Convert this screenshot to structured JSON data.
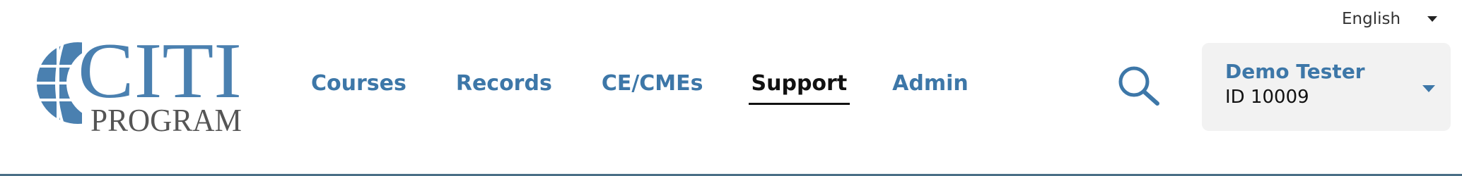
{
  "language": {
    "selected": "English",
    "caret_icon": "caret-down-icon"
  },
  "logo": {
    "line1": "CITI",
    "line2": "PROGRAM",
    "icon": "globe-icon"
  },
  "nav": {
    "items": [
      {
        "label": "Courses",
        "active": false
      },
      {
        "label": "Records",
        "active": false
      },
      {
        "label": "CE/CMEs",
        "active": false
      },
      {
        "label": "Support",
        "active": true
      },
      {
        "label": "Admin",
        "active": false
      }
    ]
  },
  "search": {
    "icon": "search-icon"
  },
  "user": {
    "name": "Demo Tester",
    "id_text": "ID 10009",
    "caret_icon": "chevron-down-icon"
  },
  "colors": {
    "brand_blue": "#3d77a8",
    "logo_blue": "#4a80b0",
    "logo_gray": "#555555",
    "panel_bg": "#f2f2f2",
    "rule": "#4a6f86"
  }
}
